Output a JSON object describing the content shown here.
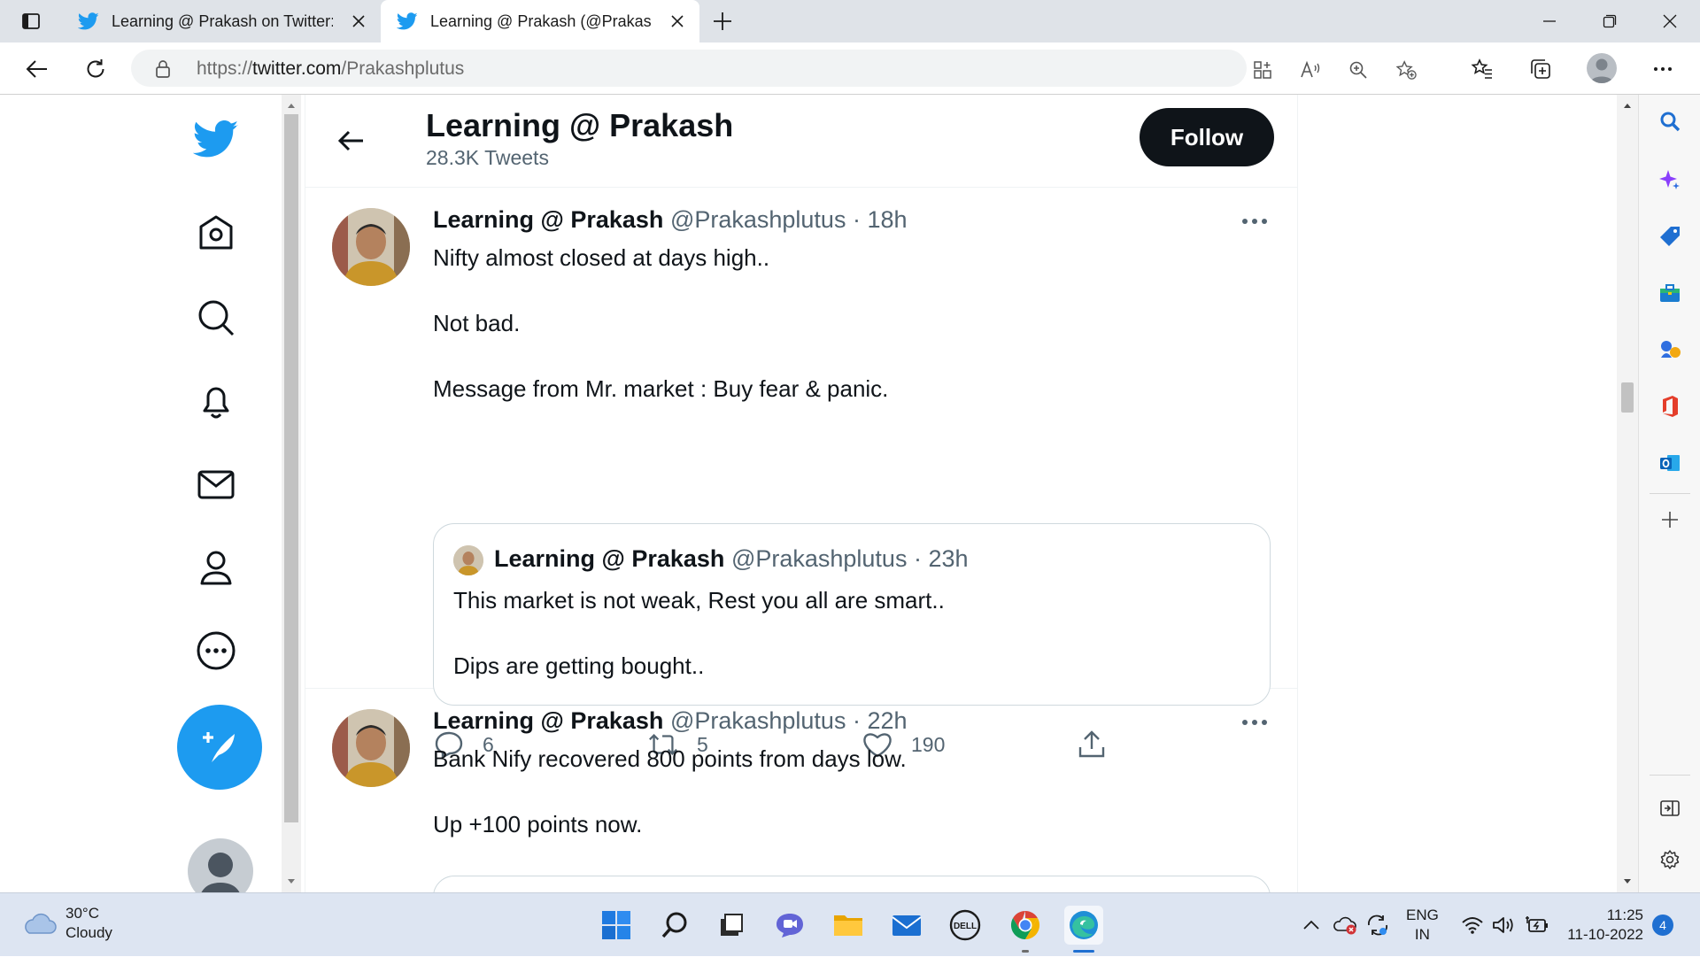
{
  "browser": {
    "tabs": [
      {
        "title": "Learning @ Prakash on Twitter: \"",
        "active": false
      },
      {
        "title": "Learning @ Prakash (@Prakashplutus)",
        "active": true
      }
    ],
    "url_prefix": "https://",
    "url_domain": "twitter.com",
    "url_path": "/Prakashplutus"
  },
  "profile_header": {
    "name": "Learning @ Prakash",
    "tweet_count": "28.3K Tweets",
    "follow_label": "Follow"
  },
  "tweets": [
    {
      "author": "Learning @ Prakash",
      "handle": "@Prakashplutus",
      "time": "· 18h",
      "paragraphs": [
        "Nifty almost closed at days high..",
        "Not bad.",
        "Message from Mr. market : Buy fear & panic."
      ],
      "quote": {
        "author": "Learning @ Prakash",
        "handle": "@Prakashplutus",
        "time": "· 23h",
        "paragraphs": [
          "This market is not weak, Rest you all are smart..",
          "Dips are getting bought.."
        ]
      },
      "replies": "6",
      "retweets": "5",
      "likes": "190"
    },
    {
      "author": "Learning @ Prakash",
      "handle": "@Prakashplutus",
      "time": "· 22h",
      "paragraphs": [
        "Bank Nify recovered 800 points from days low.",
        "Up +100 points now."
      ]
    }
  ],
  "taskbar": {
    "temperature": "30°C",
    "condition": "Cloudy",
    "lang_line1": "ENG",
    "lang_line2": "IN",
    "time": "11:25",
    "date": "11-10-2022",
    "notification_count": "4"
  },
  "colors": {
    "twitter_blue": "#1d9bf0",
    "follow_bg": "#0f1419",
    "secondary_text": "#536471"
  }
}
